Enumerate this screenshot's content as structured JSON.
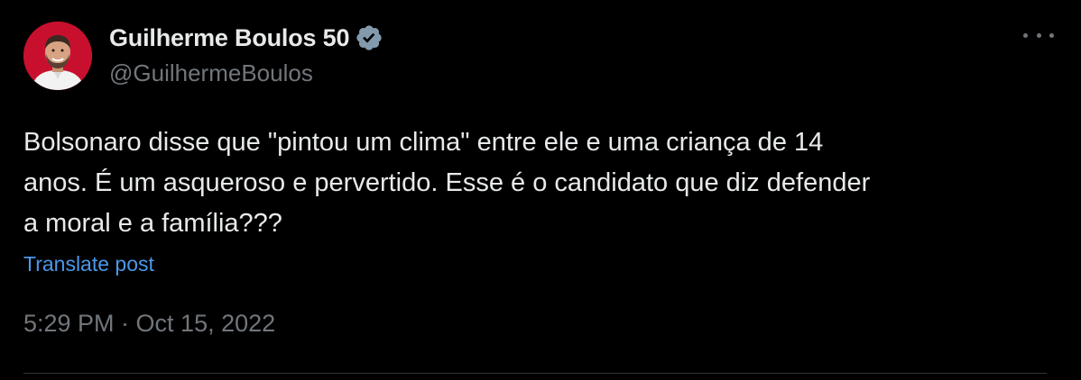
{
  "author": {
    "display_name": "Guilherme Boulos 50",
    "handle": "@GuilhermeBoulos",
    "verified_icon": "verified-badge-icon",
    "avatar_bg": "#c8102e"
  },
  "post": {
    "text": "Bolsonaro disse que \"pintou um clima\" entre ele e uma criança de 14\nanos. É um asqueroso e pervertido. Esse é o candidato que diz defender\na moral e a família???",
    "translate_label": "Translate post",
    "timestamp": "5:29 PM · Oct 15, 2022"
  },
  "colors": {
    "background": "#000000",
    "primary_text": "#e7e9ea",
    "secondary_text": "#71767b",
    "link": "#4a99e9",
    "verified": "#829aab"
  },
  "menu_icon": "more-options-icon"
}
